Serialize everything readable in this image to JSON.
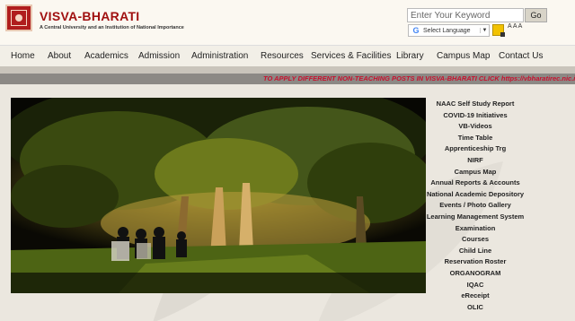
{
  "header": {
    "title": "VISVA-BHARATI",
    "subtitle": "A Central University and an Institution of National Importance",
    "search_placeholder": "Enter Your Keyword",
    "go_label": "Go",
    "translate_label": "Select Language",
    "translate_icon": "G",
    "translate_arrow": "▼",
    "font_size_control": "A A A"
  },
  "nav": {
    "items": [
      "Home",
      "About",
      "Academics",
      "Admission",
      "Administration",
      "Resources",
      "Services & Facilities",
      "Library",
      "Campus Map",
      "Contact Us"
    ]
  },
  "ticker": {
    "text": "TO APPLY DIFFERENT NON-TEACHING POSTS IN VISVA-BHARATI CLICK https://vbharatirec.nic.in"
  },
  "quick_links": [
    "NAAC Self Study Report",
    "COVID-19 Initiatives",
    "VB-Videos",
    "Time Table",
    "Apprenticeship Trg",
    "NIRF",
    "Campus Map",
    "Annual Reports & Accounts",
    "National Academic Depository",
    "Events / Photo Gallery",
    "Learning Management System",
    "Examination",
    "Courses",
    "Child Line",
    "Reservation Roster",
    "ORGANOGRAM",
    "IQAC",
    "eReceipt",
    "OLIC"
  ],
  "colors": {
    "brand": "#a01010",
    "ticker_text": "#c8102e",
    "ticker_bg": "#8c8985",
    "nav_bg": "#f2efe7"
  }
}
